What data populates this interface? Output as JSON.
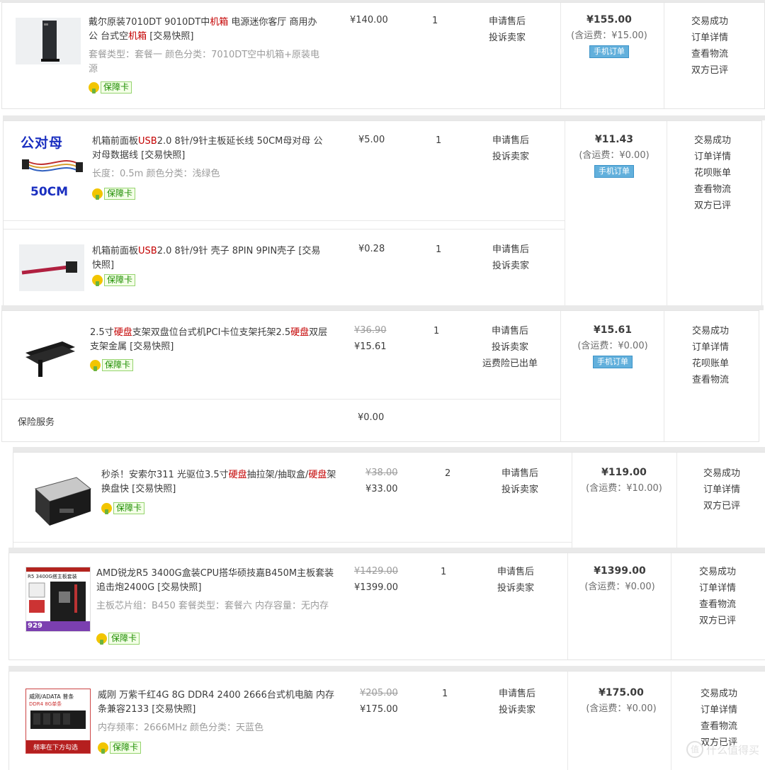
{
  "common": {
    "snapshot": "[交易快照]",
    "badge": "保障卡",
    "mobile_order": "手机订单"
  },
  "orders": [
    {
      "title_parts": [
        "戴尔原装7010DT 9010DT中",
        "机箱",
        " 电源迷你客厅 商用办公 台式空",
        "机箱",
        " "
      ],
      "attrs": "套餐类型：套餐一  颜色分类：7010DT空中机箱+原装电源",
      "price": "¥140.00",
      "qty": "1",
      "ops": [
        "申请售后",
        "投诉卖家"
      ],
      "total": "¥155.00",
      "shipping": "(含运费：¥15.00)",
      "status": [
        "交易成功",
        "订单详情",
        "查看物流",
        "双方已评"
      ]
    },
    {
      "title_parts": [
        "机箱前面板",
        "USB",
        "2.0 8针/9针主板延长线 50CM母对母 公对母数据线 "
      ],
      "attrs": "长度：0.5m  颜色分类：浅绿色",
      "thumb_text_top": "公对母",
      "thumb_text_bottom": "50CM",
      "price": "¥5.00",
      "qty": "1",
      "ops": [
        "申请售后",
        "投诉卖家"
      ],
      "total": "¥11.43",
      "shipping": "(含运费：¥0.00)",
      "status": [
        "交易成功",
        "订单详情",
        "花呗账单",
        "查看物流",
        "双方已评"
      ],
      "item2": {
        "title_parts": [
          "机箱前面板",
          "USB",
          "2.0 8针/9针 壳子 8PIN 9PIN壳子 "
        ],
        "price": "¥0.28",
        "qty": "1",
        "ops": [
          "申请售后",
          "投诉卖家"
        ]
      }
    },
    {
      "title_parts": [
        "2.5寸",
        "硬盘",
        "支架双盘位台式机PCI卡位支架托架2.5",
        "硬盘",
        "双层支架金属 "
      ],
      "price_orig": "¥36.90",
      "price": "¥15.61",
      "qty": "1",
      "ops": [
        "申请售后",
        "投诉卖家",
        "运费险已出单"
      ],
      "total": "¥15.61",
      "shipping": "(含运费：¥0.00)",
      "status": [
        "交易成功",
        "订单详情",
        "花呗账单",
        "查看物流"
      ],
      "insurance_label": "保险服务",
      "insurance_price": "¥0.00"
    },
    {
      "title_parts": [
        "秒杀！安索尔311 光驱位3.5寸",
        "硬盘",
        "抽拉架/抽取盒/",
        "硬盘",
        "架 换盘快 "
      ],
      "price_orig": "¥38.00",
      "price": "¥33.00",
      "qty": "2",
      "ops": [
        "申请售后",
        "投诉卖家"
      ],
      "total": "¥119.00",
      "shipping": "(含运费：¥10.00)",
      "status": [
        "交易成功",
        "订单详情",
        "双方已评"
      ]
    },
    {
      "title_parts": [
        "AMD锐龙R5 3400G盒装CPU搭华硕技嘉B450M主板套装 追击炮2400G "
      ],
      "attrs": "主板芯片组：B450  套餐类型：套餐六  内存容量：无内存",
      "thumb_text_top": "R5 3400G搭主板套装",
      "thumb_text_bottom": "929",
      "price_orig": "¥1429.00",
      "price": "¥1399.00",
      "qty": "1",
      "ops": [
        "申请售后",
        "投诉卖家"
      ],
      "total": "¥1399.00",
      "shipping": "(含运费：¥0.00)",
      "status": [
        "交易成功",
        "订单详情",
        "查看物流",
        "双方已评"
      ]
    },
    {
      "title_parts": [
        "威刚 万紫千红4G 8G DDR4 2400 2666台式机电脑 内存条兼容2133 "
      ],
      "attrs": "内存频率：2666MHz  颜色分类：天蓝色",
      "thumb_text_top": "威刚/ADATA 普条",
      "thumb_text_mid": "DDR4 8G单条",
      "thumb_text_bottom": "频率在下方勾选",
      "price_orig": "¥205.00",
      "price": "¥175.00",
      "qty": "1",
      "ops": [
        "申请售后",
        "投诉卖家"
      ],
      "total": "¥175.00",
      "shipping": "(含运费：¥0.00)",
      "status": [
        "交易成功",
        "订单详情",
        "查看物流",
        "双方已评"
      ]
    }
  ],
  "watermark": {
    "icon": "值",
    "text": "什么值得买"
  }
}
